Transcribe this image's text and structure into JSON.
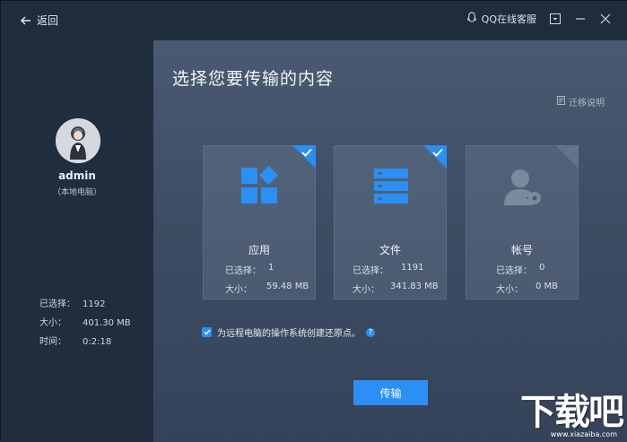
{
  "titlebar": {
    "back_label": "返回",
    "qq_label": "QQ在线客服"
  },
  "user": {
    "name": "admin",
    "subtitle": "（本地电脑）"
  },
  "summary": {
    "selected_label": "已选择：",
    "selected_value": "1192",
    "size_label": "大小：",
    "size_value": "401.30 MB",
    "time_label": "时间：",
    "time_value": "0:2:18"
  },
  "main": {
    "title": "选择您要传输的内容",
    "help_link": "迁移说明",
    "restore_label": "为远程电脑的操作系统创建还原点。",
    "transfer_button": "传输"
  },
  "cards": [
    {
      "name": "应用",
      "selected_label": "已选择：",
      "selected_value": "1",
      "size_label": "大小：",
      "size_value": "59.48 MB",
      "checked": true,
      "icon": "apps-icon"
    },
    {
      "name": "文件",
      "selected_label": "已选择：",
      "selected_value": "1191",
      "size_label": "大小：",
      "size_value": "341.83 MB",
      "checked": true,
      "icon": "files-icon"
    },
    {
      "name": "帐号",
      "selected_label": "已选择：",
      "selected_value": "0",
      "size_label": "大小：",
      "size_value": "0 MB",
      "checked": false,
      "icon": "account-icon"
    }
  ],
  "watermark": {
    "text": "下载吧",
    "url": "www.xiazaiba.com"
  },
  "colors": {
    "accent": "#2b8ff3",
    "sidebar": "#1f2d3e",
    "main_bg": "#3e4d63"
  }
}
